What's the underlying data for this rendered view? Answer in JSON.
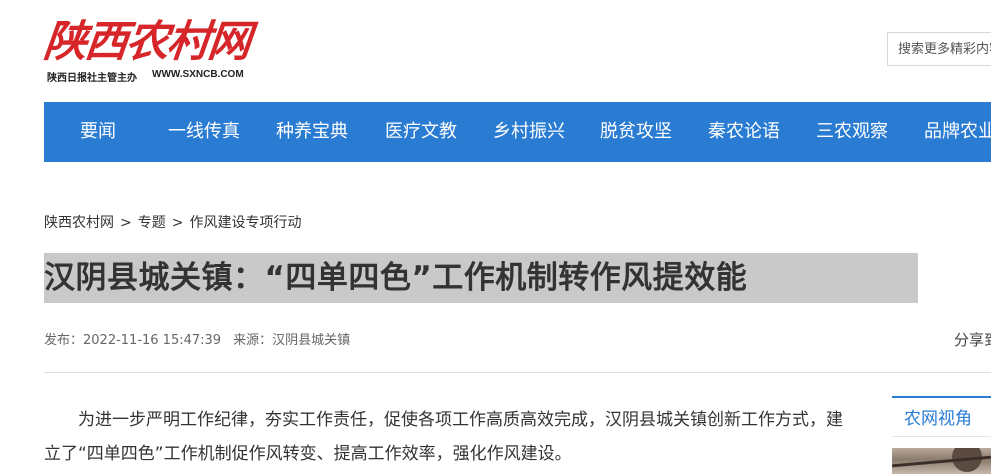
{
  "site": {
    "logo_title": "陕西农村网",
    "logo_subtitle": "陕西日报社主管主办",
    "logo_url": "WWW.SXNCB.COM"
  },
  "search": {
    "placeholder": "搜索更多精彩内容"
  },
  "nav": {
    "items": [
      "要闻",
      "一线传真",
      "种养宝典",
      "医疗文教",
      "乡村振兴",
      "脱贫攻坚",
      "秦农论语",
      "三农观察",
      "品牌农业"
    ]
  },
  "breadcrumb": {
    "items": [
      "陕西农村网",
      "专题",
      "作风建设专项行动"
    ],
    "separator": ">"
  },
  "article": {
    "title": "汉阴县城关镇：“四单四色”工作机制转作风提效能",
    "published": "发布：2022-11-16 15:47:39",
    "source": "来源：汉阴县城关镇",
    "share_label": "分享到",
    "paragraph_1": "为进一步严明工作纪律，夯实工作责任，促使各项工作高质高效完成，汉阴县城关镇创新工作方式，建立了“四单四色”工作机制促作风转变、提高工作效率，强化作风建设。"
  },
  "sidebar": {
    "section_title": "农网视角"
  },
  "colors": {
    "brand_red": "#d6262a",
    "nav_blue": "#2a7cd3",
    "headline_highlight": "#c9c9c9"
  }
}
